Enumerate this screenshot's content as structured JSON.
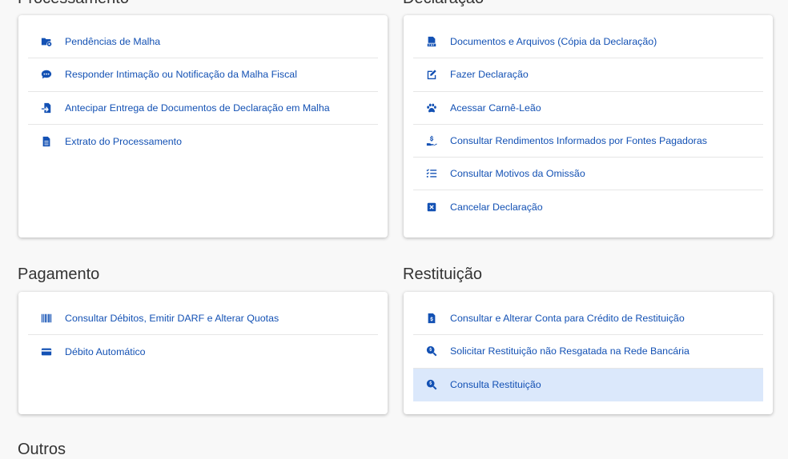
{
  "colors": {
    "link": "#1351b4",
    "active_bg": "#dbe8fb",
    "title": "#333333"
  },
  "sections": {
    "processamento": {
      "title": "Processamento",
      "items": [
        {
          "label": "Pendências de Malha",
          "icon": "folder-gear-icon"
        },
        {
          "label": "Responder Intimação ou Notificação da Malha Fiscal",
          "icon": "comment-dots-icon"
        },
        {
          "label": "Antecipar Entrega de Documentos de Declaração em Malha",
          "icon": "file-import-icon"
        },
        {
          "label": "Extrato do Processamento",
          "icon": "file-lines-icon"
        }
      ]
    },
    "declaracao": {
      "title": "Declaração",
      "items": [
        {
          "label": "Documentos e Arquivos (Cópia da Declaração)",
          "icon": "file-pdf-icon"
        },
        {
          "label": "Fazer Declaração",
          "icon": "edit-icon"
        },
        {
          "label": "Acessar Carnê-Leão",
          "icon": "paw-icon"
        },
        {
          "label": "Consultar Rendimentos Informados por Fontes Pagadoras",
          "icon": "hand-holding-dollar-icon"
        },
        {
          "label": "Consultar Motivos da Omissão",
          "icon": "list-check-icon"
        },
        {
          "label": "Cancelar Declaração",
          "icon": "square-xmark-icon"
        }
      ]
    },
    "pagamento": {
      "title": "Pagamento",
      "items": [
        {
          "label": "Consultar Débitos, Emitir DARF e Alterar Quotas",
          "icon": "barcode-icon"
        },
        {
          "label": "Débito Automático",
          "icon": "credit-card-icon"
        }
      ]
    },
    "restituicao": {
      "title": "Restituição",
      "items": [
        {
          "label": "Consultar e Alterar Conta para Crédito de Restituição",
          "icon": "file-invoice-dollar-icon"
        },
        {
          "label": "Solicitar Restituição não Resgatada na Rede Bancária",
          "icon": "search-dollar-icon"
        },
        {
          "label": "Consulta Restituição",
          "icon": "search-dollar-icon",
          "active": true
        }
      ]
    },
    "outros": {
      "title": "Outros"
    }
  }
}
